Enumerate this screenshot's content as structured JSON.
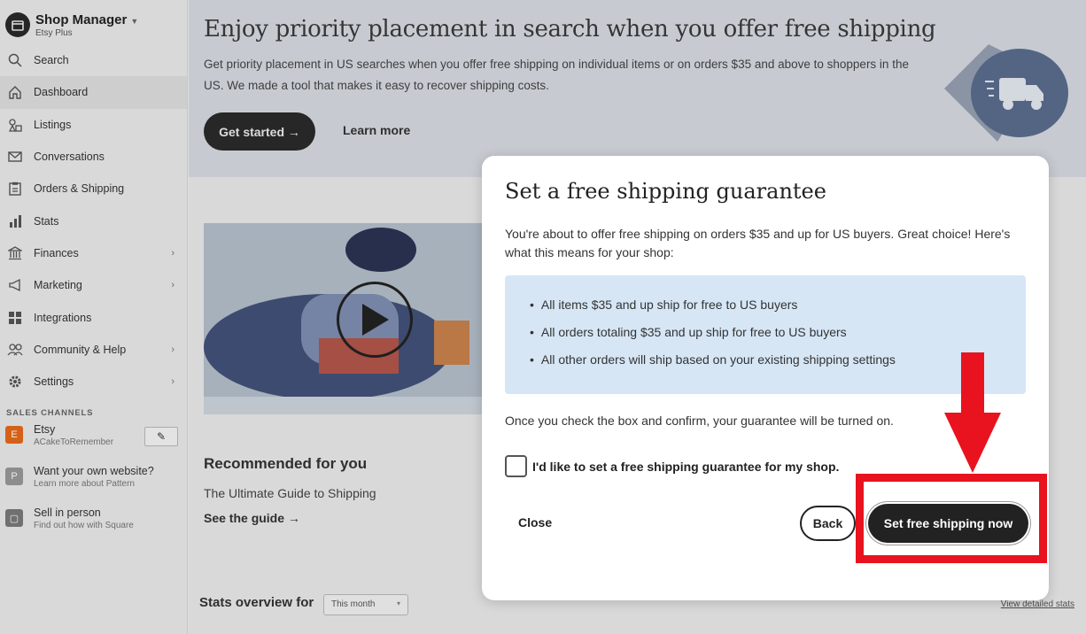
{
  "sidebar": {
    "brand_title": "Shop Manager",
    "brand_sub": "Etsy Plus",
    "items": [
      {
        "label": "Search",
        "icon": "search-icon"
      },
      {
        "label": "Dashboard",
        "icon": "home-icon",
        "active": true
      },
      {
        "label": "Listings",
        "icon": "shapes-icon"
      },
      {
        "label": "Conversations",
        "icon": "mail-icon"
      },
      {
        "label": "Orders & Shipping",
        "icon": "clipboard-icon"
      },
      {
        "label": "Stats",
        "icon": "bar-chart-icon"
      },
      {
        "label": "Finances",
        "icon": "bank-icon",
        "chevron": true
      },
      {
        "label": "Marketing",
        "icon": "megaphone-icon",
        "chevron": true
      },
      {
        "label": "Integrations",
        "icon": "grid-icon"
      },
      {
        "label": "Community & Help",
        "icon": "people-icon",
        "chevron": true
      },
      {
        "label": "Settings",
        "icon": "gear-icon",
        "chevron": true
      }
    ],
    "sales_channels_heading": "SALES CHANNELS",
    "channels": [
      {
        "title": "Etsy",
        "sub": "ACakeToRemember",
        "badge": "E",
        "color": "#e86a1a"
      },
      {
        "title": "Want your own website?",
        "sub": "Learn more about Pattern",
        "badge": "P",
        "color": "#9a9a9a"
      },
      {
        "title": "Sell in person",
        "sub": "Find out how with Square",
        "badge": "▢",
        "color": "#7a7a7a"
      }
    ]
  },
  "hero": {
    "title": "Enjoy priority placement in search when you offer free shipping",
    "text": "Get priority placement in US searches when you offer free shipping on individual items or on orders $35 and above to shoppers in the US. We made a tool that makes it easy to recover shipping costs.",
    "get_started": "Get started →",
    "learn_more": "Learn more"
  },
  "recommended": {
    "title": "Recommended for you",
    "sub": "The Ultimate Guide to Shipping",
    "link": "See the guide →"
  },
  "stats": {
    "title": "Stats overview for",
    "period": "This month",
    "link": "View detailed stats"
  },
  "modal": {
    "title": "Set a free shipping guarantee",
    "intro": "You're about to offer free shipping on orders $35 and up for US buyers. Great choice! Here's what this means for your shop:",
    "points": [
      "All items $35 and up ship for free to US buyers",
      "All orders totaling $35 and up ship for free to US buyers",
      "All other orders will ship based on your existing shipping settings"
    ],
    "confirm_text": "Once you check the box and confirm, your guarantee will be turned on.",
    "checkbox_label": "I'd like to set a free shipping guarantee for my shop.",
    "close": "Close",
    "back": "Back",
    "primary": "Set free shipping now"
  },
  "colors": {
    "accent": "#222222",
    "annotation_red": "#e8131e",
    "info_box": "#d6e6f5"
  }
}
